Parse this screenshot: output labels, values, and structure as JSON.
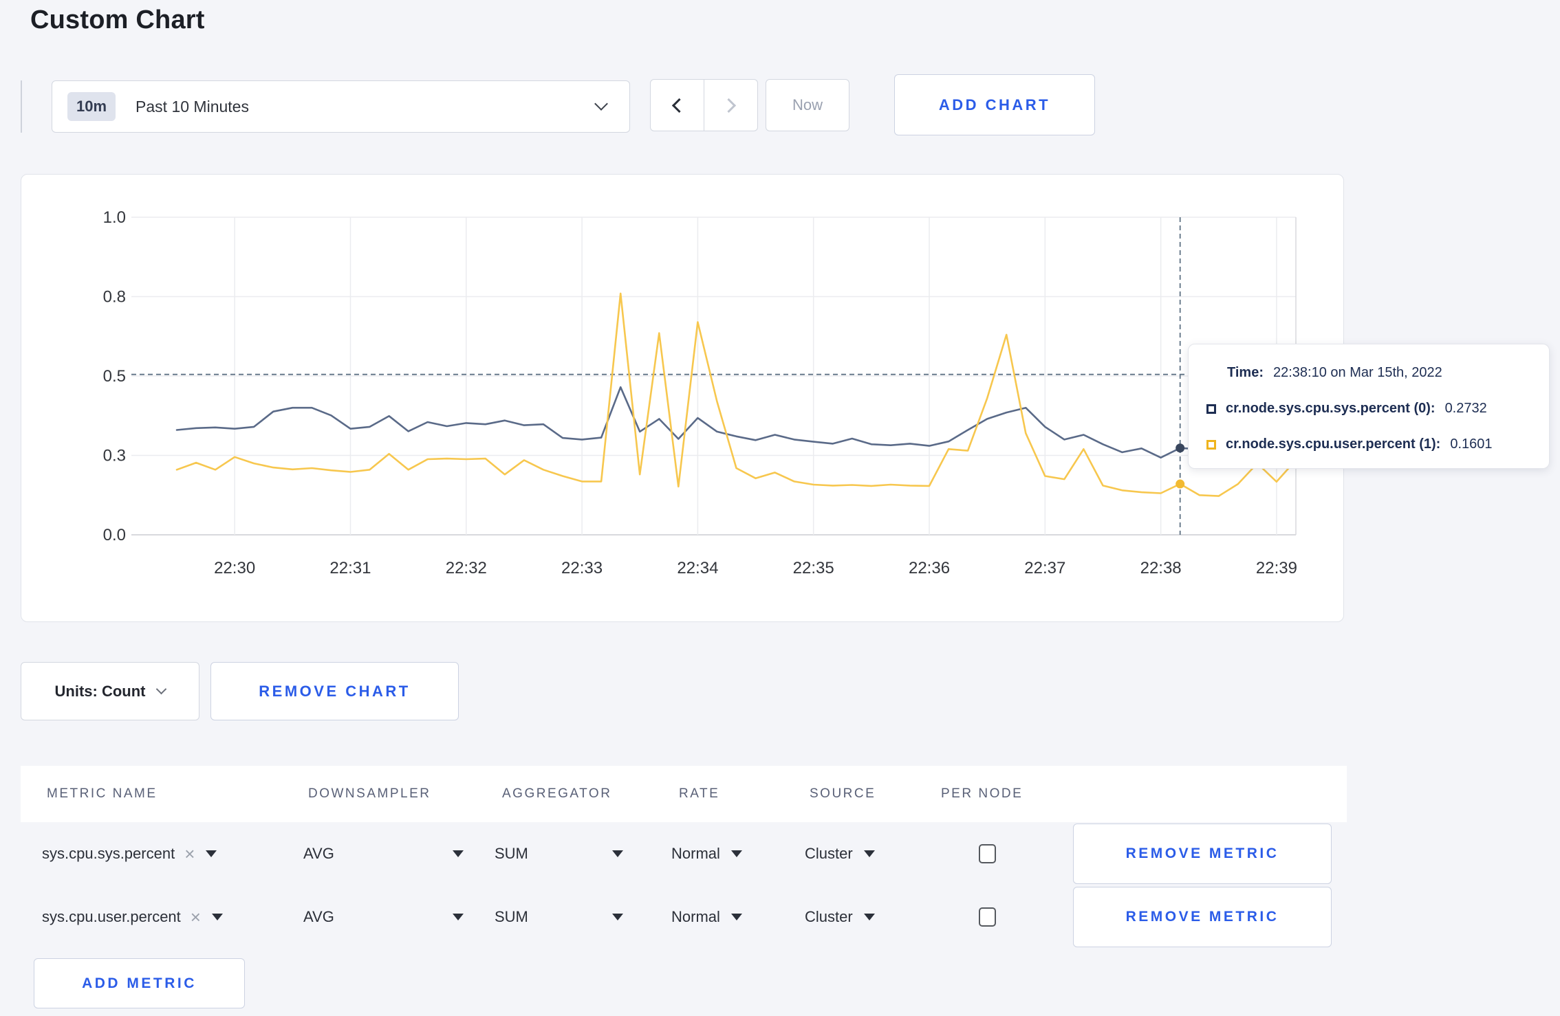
{
  "page": {
    "title": "Custom Chart"
  },
  "colors": {
    "accent_blue": "#2b5ce8",
    "series_sys_line": "#5a6a88",
    "series_user_line": "#f7c74e",
    "series_sys_dot": "#39465e",
    "series_user_dot": "#f2ba31",
    "crosshair": "#5e7184",
    "gridline": "#ebecef",
    "axisline": "#d8d9dd"
  },
  "toolbar": {
    "time_range": {
      "badge": "10m",
      "label": "Past 10 Minutes"
    },
    "now_label": "Now",
    "add_chart_label": "ADD CHART"
  },
  "chart": {
    "tooltip": {
      "time_label": "Time:",
      "time_value": "22:38:10 on Mar 15th, 2022",
      "series": [
        {
          "name": "cr.node.sys.cpu.sys.percent (0):",
          "value": "0.2732"
        },
        {
          "name": "cr.node.sys.cpu.user.percent (1):",
          "value": "0.1601"
        }
      ]
    }
  },
  "chart_data": {
    "type": "line",
    "title": "",
    "xlabel": "",
    "ylabel": "",
    "ylim": [
      0,
      1
    ],
    "grid": true,
    "x_start_time": "22:29:30",
    "x_interval_seconds": 10,
    "x_total_seconds": 580,
    "x_tick_labels": [
      "22:30",
      "22:31",
      "22:32",
      "22:33",
      "22:34",
      "22:35",
      "22:36",
      "22:37",
      "22:38",
      "22:39"
    ],
    "y_ticks": [
      {
        "value": 0.0,
        "label": "0.0"
      },
      {
        "value": 0.25,
        "label": "0.3"
      },
      {
        "value": 0.5,
        "label": "0.5"
      },
      {
        "value": 0.75,
        "label": "0.8"
      },
      {
        "value": 1.0,
        "label": "1.0"
      }
    ],
    "series": [
      {
        "name": "cr.node.sys.cpu.sys.percent (0)",
        "values": [
          0.33,
          0.336,
          0.338,
          0.334,
          0.34,
          0.388,
          0.4,
          0.4,
          0.376,
          0.334,
          0.34,
          0.374,
          0.326,
          0.355,
          0.342,
          0.352,
          0.348,
          0.36,
          0.345,
          0.348,
          0.305,
          0.3,
          0.306,
          0.465,
          0.325,
          0.365,
          0.302,
          0.368,
          0.325,
          0.31,
          0.298,
          0.315,
          0.3,
          0.293,
          0.287,
          0.303,
          0.285,
          0.282,
          0.287,
          0.28,
          0.294,
          0.33,
          0.365,
          0.385,
          0.4,
          0.34,
          0.3,
          0.315,
          0.285,
          0.26,
          0.272,
          0.243,
          0.2732,
          0.27,
          0.29,
          0.3,
          0.3,
          0.3,
          0.3
        ]
      },
      {
        "name": "cr.node.sys.cpu.user.percent (1)",
        "values": [
          0.205,
          0.227,
          0.205,
          0.245,
          0.225,
          0.212,
          0.206,
          0.21,
          0.203,
          0.198,
          0.205,
          0.255,
          0.205,
          0.238,
          0.24,
          0.238,
          0.24,
          0.19,
          0.235,
          0.205,
          0.185,
          0.168,
          0.168,
          0.76,
          0.19,
          0.635,
          0.152,
          0.67,
          0.42,
          0.21,
          0.178,
          0.196,
          0.168,
          0.158,
          0.155,
          0.157,
          0.154,
          0.158,
          0.155,
          0.154,
          0.27,
          0.265,
          0.43,
          0.63,
          0.32,
          0.185,
          0.175,
          0.27,
          0.155,
          0.14,
          0.134,
          0.131,
          0.1601,
          0.125,
          0.122,
          0.16,
          0.225,
          0.167,
          0.235
        ]
      }
    ],
    "crosshair": {
      "index": 52,
      "time": "22:38:10",
      "guide_value": 0.505
    },
    "legend_position": "tooltip"
  },
  "units_bar": {
    "units_label": "Units: Count",
    "remove_chart_label": "REMOVE CHART"
  },
  "metrics_table": {
    "headers": [
      "Metric Name",
      "Downsampler",
      "Aggregator",
      "Rate",
      "Source",
      "Per Node"
    ],
    "rows": [
      {
        "metric": "sys.cpu.sys.percent",
        "downsampler": "AVG",
        "aggregator": "SUM",
        "rate": "Normal",
        "source": "Cluster",
        "per_node": false,
        "remove_label": "REMOVE METRIC"
      },
      {
        "metric": "sys.cpu.user.percent",
        "downsampler": "AVG",
        "aggregator": "SUM",
        "rate": "Normal",
        "source": "Cluster",
        "per_node": false,
        "remove_label": "REMOVE METRIC"
      }
    ],
    "add_metric_label": "ADD METRIC"
  }
}
